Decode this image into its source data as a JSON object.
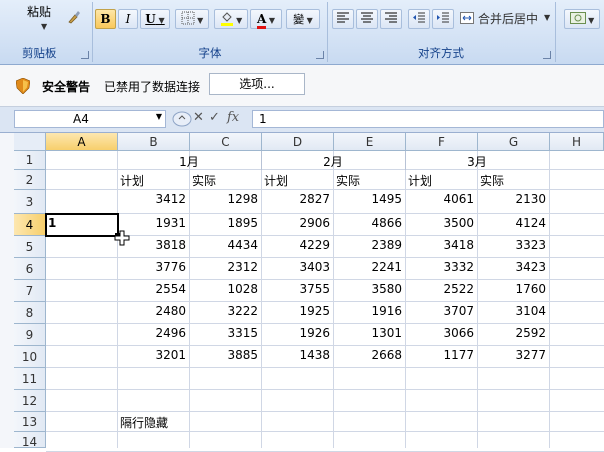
{
  "ribbon": {
    "clipboard": {
      "paste_label": "粘贴",
      "group_label": "剪贴板"
    },
    "font": {
      "bold": "B",
      "italic": "I",
      "underline": "U",
      "font_color_glyph": "A",
      "phonetic_glyph": "變",
      "group_label": "字体"
    },
    "alignment": {
      "merge_center": "合并后居中",
      "group_label": "对齐方式"
    }
  },
  "security_bar": {
    "title": "安全警告",
    "message": "已禁用了数据连接",
    "options_button": "选项..."
  },
  "formula_bar": {
    "name_box": "A4",
    "formula": "1"
  },
  "sheet": {
    "columns": [
      "A",
      "B",
      "C",
      "D",
      "E",
      "F",
      "G",
      "H"
    ],
    "rows": [
      "1",
      "2",
      "3",
      "4",
      "5",
      "6",
      "7",
      "8",
      "9",
      "10",
      "11",
      "12",
      "13",
      "14"
    ],
    "active_cell": "A4",
    "active_value": "1",
    "month_headers": [
      "1月",
      "2月",
      "3月"
    ],
    "sub_headers": [
      "计划",
      "实际",
      "计划",
      "实际",
      "计划",
      "实际"
    ],
    "data": [
      [
        3412,
        1298,
        2827,
        1495,
        4061,
        2130
      ],
      [
        1931,
        1895,
        2906,
        4866,
        3500,
        4124
      ],
      [
        3818,
        4434,
        4229,
        2389,
        3418,
        3323
      ],
      [
        3776,
        2312,
        3403,
        2241,
        3332,
        3423
      ],
      [
        2554,
        1028,
        3755,
        3580,
        2522,
        1760
      ],
      [
        2480,
        3222,
        1925,
        1916,
        3707,
        3104
      ],
      [
        2496,
        3315,
        1926,
        1301,
        3066,
        2592
      ],
      [
        3201,
        3885,
        1438,
        2668,
        1177,
        3277
      ]
    ],
    "note_cell": "隔行隐藏"
  },
  "colors": {
    "ribbon_label": "#15428b",
    "selected_header": "#f7cf6c",
    "gridline": "#d0d7e5"
  }
}
